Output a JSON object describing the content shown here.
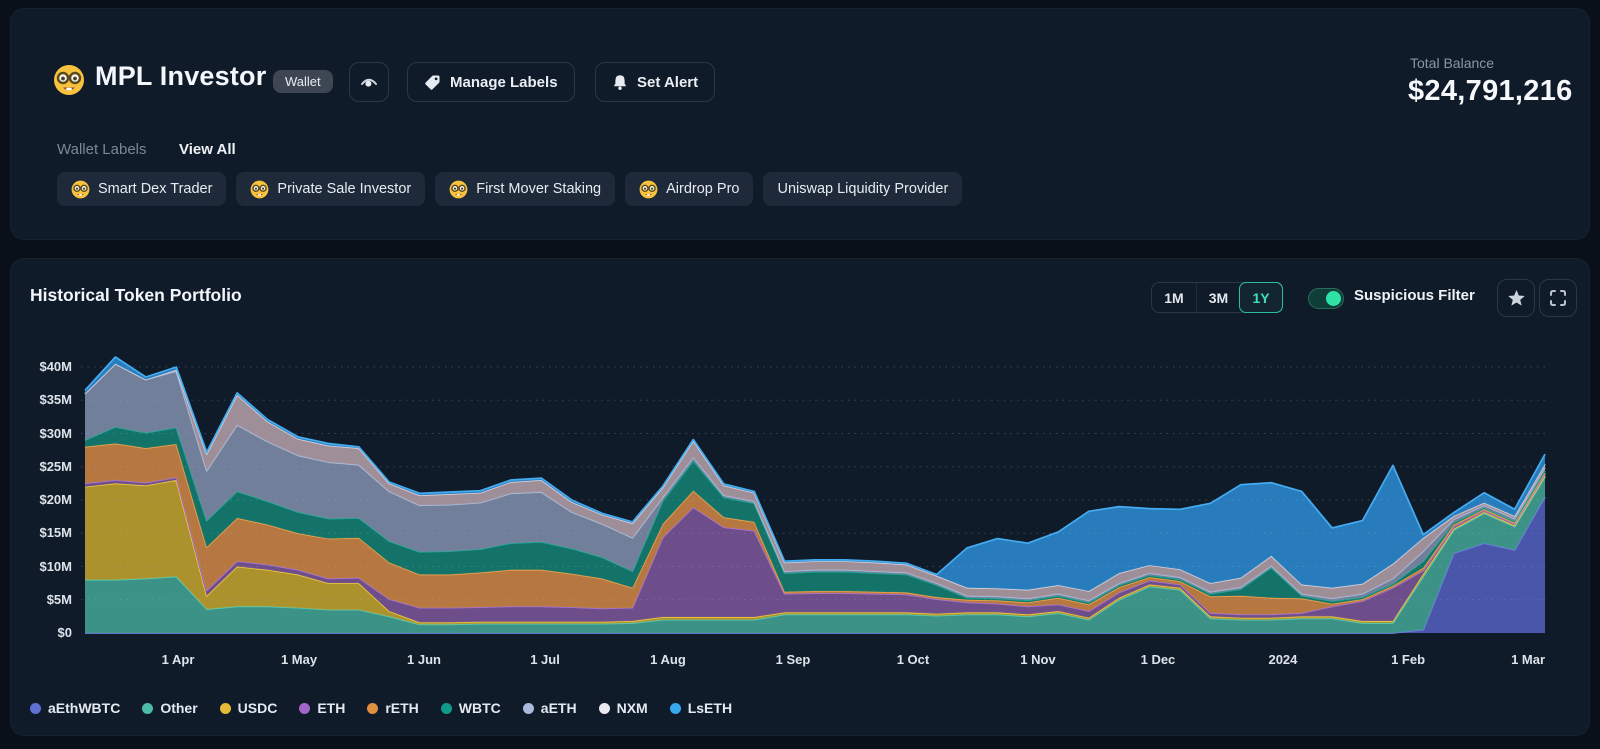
{
  "header": {
    "title": "MPL Investor",
    "badge": "Wallet",
    "manage_labels": "Manage Labels",
    "set_alert": "Set Alert",
    "total_balance_label": "Total Balance",
    "total_balance_value": "$24,791,216"
  },
  "labels_section": {
    "caption": "Wallet Labels",
    "view_all": "View All",
    "chips": [
      {
        "text": "Smart Dex Trader",
        "emoji": true
      },
      {
        "text": "Private Sale Investor",
        "emoji": true
      },
      {
        "text": "First Mover Staking",
        "emoji": true
      },
      {
        "text": "Airdrop Pro",
        "emoji": true
      },
      {
        "text": "Uniswap Liquidity Provider",
        "emoji": false
      }
    ]
  },
  "chart_header": {
    "title": "Historical Token Portfolio",
    "range_buttons": [
      "1M",
      "3M",
      "1Y"
    ],
    "active_range": "1Y",
    "toggle_label": "Suspicious Filter",
    "toggle_on": true,
    "accent_color": "#2fe3a6"
  },
  "chart_data": {
    "type": "area",
    "stacked": true,
    "title": "Historical Token Portfolio",
    "unit": "$M",
    "ylim": [
      0,
      43
    ],
    "grid": "dotted-horizontal",
    "legend_position": "bottom",
    "y_ticks": [
      {
        "v": 0,
        "label": "$0"
      },
      {
        "v": 5,
        "label": "$5M"
      },
      {
        "v": 10,
        "label": "$10M"
      },
      {
        "v": 15,
        "label": "$15M"
      },
      {
        "v": 20,
        "label": "$20M"
      },
      {
        "v": 25,
        "label": "$25M"
      },
      {
        "v": 30,
        "label": "$30M"
      },
      {
        "v": 35,
        "label": "$35M"
      },
      {
        "v": 40,
        "label": "$40M"
      }
    ],
    "x_ticks": [
      {
        "f": 0.0637,
        "label": "1 Apr"
      },
      {
        "f": 0.1466,
        "label": "1 May"
      },
      {
        "f": 0.2322,
        "label": "1 Jun"
      },
      {
        "f": 0.3151,
        "label": "1 Jul"
      },
      {
        "f": 0.3993,
        "label": "1 Aug"
      },
      {
        "f": 0.4849,
        "label": "1 Sep"
      },
      {
        "f": 0.5671,
        "label": "1 Oct"
      },
      {
        "f": 0.6527,
        "label": "1 Nov"
      },
      {
        "f": 0.7349,
        "label": "1 Dec"
      },
      {
        "f": 0.8205,
        "label": "2024"
      },
      {
        "f": 0.9062,
        "label": "1 Feb"
      },
      {
        "f": 0.9884,
        "label": "1 Mar"
      }
    ],
    "series": [
      {
        "name": "aEthWBTC",
        "dot": "#5f6fd3",
        "fill": "#4c58b0",
        "stroke": "#6e7ee0",
        "values": [
          0,
          0,
          0,
          0,
          0,
          0,
          0,
          0,
          0,
          0,
          0,
          0,
          0,
          0,
          0,
          0,
          0,
          0,
          0,
          0,
          0,
          0,
          0,
          0,
          0,
          0,
          0,
          0,
          0,
          0,
          0,
          0,
          0,
          0,
          0,
          0,
          0,
          0,
          0,
          0,
          0,
          0,
          0,
          0,
          0.5,
          12,
          13.5,
          12.5,
          20.5
        ]
      },
      {
        "name": "Other",
        "dot": "#4cbcaa",
        "fill": "#3f978b",
        "stroke": "#54cbb6",
        "values": [
          8,
          8,
          8.2,
          8.5,
          3.6,
          4,
          4,
          3.8,
          3.5,
          3.5,
          2.5,
          1.3,
          1.3,
          1.4,
          1.4,
          1.4,
          1.4,
          1.4,
          1.5,
          2,
          2,
          2,
          2,
          2.8,
          2.8,
          2.8,
          2.8,
          2.8,
          2.6,
          2.8,
          2.8,
          2.5,
          3,
          2,
          5,
          7,
          6.5,
          2.2,
          2,
          2,
          2.2,
          2.2,
          1.5,
          1.5,
          8,
          3.5,
          4.5,
          3.5,
          3
        ]
      },
      {
        "name": "USDC",
        "dot": "#e6bb37",
        "fill": "#b3972e",
        "stroke": "#eec83e",
        "values": [
          14,
          14.5,
          14,
          14.5,
          2,
          6,
          5.5,
          5,
          4,
          4,
          0.8,
          0.3,
          0.3,
          0.3,
          0.3,
          0.3,
          0.3,
          0.3,
          0.3,
          0.4,
          0.4,
          0.4,
          0.4,
          0.3,
          0.3,
          0.3,
          0.3,
          0.3,
          0.3,
          0.3,
          0.3,
          0.3,
          0.3,
          0.3,
          0.3,
          0.3,
          0.3,
          0.3,
          0.3,
          0.3,
          0.3,
          0.3,
          0.3,
          0.3,
          0.4,
          0.2,
          0.2,
          0.2,
          0.2
        ]
      },
      {
        "name": "ETH",
        "dot": "#a266c9",
        "fill": "#71508f",
        "stroke": "#a471d4",
        "values": [
          0.5,
          0.5,
          0.4,
          0.4,
          0.8,
          0.8,
          0.8,
          0.7,
          0.7,
          0.8,
          1.8,
          2.2,
          2.2,
          2.2,
          2.3,
          2.3,
          2.2,
          2,
          2,
          12,
          16.5,
          13.5,
          13,
          2.8,
          2.9,
          2.9,
          2.8,
          2.7,
          2.2,
          1.5,
          1.3,
          1.2,
          1,
          1,
          0.8,
          0.6,
          0.5,
          0.5,
          0.5,
          0.5,
          0.5,
          1.5,
          3,
          5,
          0.5,
          0.3,
          0.2,
          0.2,
          0.2
        ]
      },
      {
        "name": "rETH",
        "dot": "#e0913f",
        "fill": "#bd7c42",
        "stroke": "#f0a14c",
        "values": [
          5.5,
          5.5,
          5.2,
          5,
          6.5,
          6.5,
          6,
          5.5,
          6,
          6,
          5.5,
          5,
          5,
          5.2,
          5.5,
          5.5,
          5,
          4.5,
          3,
          2,
          2.5,
          1.5,
          1.3,
          0.3,
          0.3,
          0.3,
          0.3,
          0.3,
          0.3,
          0.4,
          0.5,
          0.6,
          1,
          1,
          0.8,
          0.5,
          0.5,
          2.5,
          2.8,
          2.5,
          2.2,
          0.4,
          0.3,
          0.3,
          0.4,
          0.3,
          0.2,
          0.2,
          0.2
        ]
      },
      {
        "name": "WBTC",
        "dot": "#119a89",
        "fill": "#14776b",
        "stroke": "#1ba691",
        "values": [
          1,
          2.5,
          2.3,
          2.5,
          4,
          4,
          3.5,
          3.2,
          3,
          3,
          3.2,
          3.4,
          3.5,
          3.5,
          4,
          4.2,
          3.8,
          3.2,
          2.5,
          3.5,
          4.5,
          3,
          2.8,
          2.8,
          2.9,
          2.9,
          2.8,
          2.7,
          1.8,
          0.3,
          0.3,
          0.3,
          0.3,
          0.3,
          0.3,
          0.3,
          0.3,
          0.4,
          1,
          4.5,
          0.4,
          0.4,
          0.3,
          0.3,
          1,
          0.3,
          0.2,
          0.2,
          0.3
        ]
      },
      {
        "name": "aETH",
        "dot": "#a9bade",
        "fill": "#76839f",
        "stroke": "#a9bcdb",
        "values": [
          7,
          9.5,
          8,
          8.5,
          7.5,
          10,
          9,
          8.5,
          8.5,
          8,
          7.5,
          7,
          7,
          7,
          7.5,
          7.5,
          5.5,
          5,
          5,
          0.5,
          0.5,
          0.3,
          0.3,
          0.3,
          0.3,
          0.3,
          0.3,
          0.3,
          0.3,
          0.3,
          0.3,
          0.3,
          0.3,
          0.3,
          0.3,
          0.3,
          0.3,
          0.3,
          0.3,
          0.3,
          0.3,
          0.4,
          0.5,
          0.8,
          1.5,
          0.5,
          0.4,
          0.4,
          0.5
        ]
      },
      {
        "name": "NXM",
        "dot": "#ece9ee",
        "fill": "#a4939d",
        "stroke": "#d9cfd7",
        "values": [
          0,
          0,
          0,
          0.2,
          2.5,
          4.5,
          3,
          2.5,
          2.5,
          2.5,
          1.2,
          1.5,
          1.6,
          1.5,
          1.7,
          1.8,
          1.5,
          1.4,
          2.2,
          1.5,
          2.5,
          1.5,
          1.3,
          1.3,
          1.3,
          1.3,
          1.3,
          1.2,
          1.1,
          1.2,
          1.2,
          1.3,
          1.3,
          1.4,
          1.5,
          1.2,
          1.2,
          1.3,
          1.4,
          1.5,
          1.4,
          1.6,
          1.5,
          2.2,
          2,
          0.5,
          0.4,
          0.4,
          0.5
        ]
      },
      {
        "name": "LsETH",
        "dot": "#38a8ee",
        "fill": "#2a80c3",
        "stroke": "#44adf2",
        "values": [
          0.5,
          1,
          0.4,
          0.4,
          0.3,
          0.3,
          0.3,
          0.3,
          0.3,
          0.2,
          0.2,
          0.3,
          0.3,
          0.3,
          0.3,
          0.3,
          0.3,
          0.2,
          0.2,
          0.2,
          0.2,
          0.2,
          0.2,
          0.2,
          0.2,
          0.2,
          0.2,
          0.2,
          0.2,
          6,
          7.5,
          7,
          8,
          12,
          10,
          8.5,
          9,
          12,
          14,
          11,
          14,
          9,
          9.5,
          14.8,
          0.5,
          0.5,
          1.5,
          1,
          1.5
        ]
      }
    ]
  }
}
